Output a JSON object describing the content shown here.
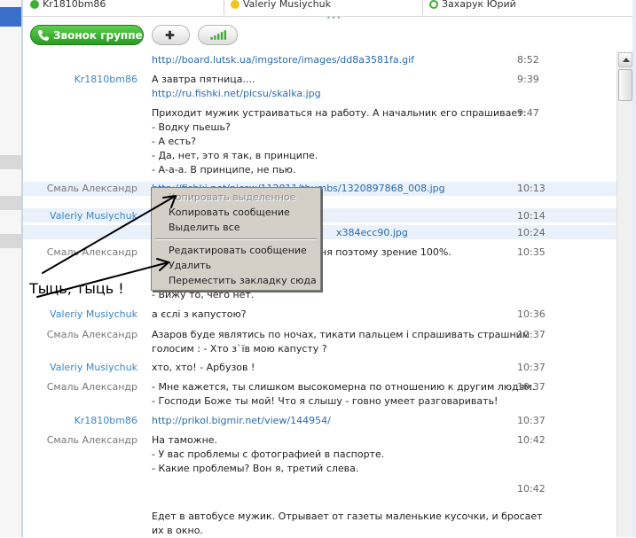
{
  "participants": [
    {
      "name": "Kr1810bm86",
      "icon": "skype-status-icon"
    },
    {
      "name": "Valeriy Musiychuk",
      "icon": "skype-away-icon"
    },
    {
      "name": "Захарук Юрий",
      "icon": "skype-status-icon"
    }
  ],
  "toolbar": {
    "call_group_label": "Звонок группе",
    "add_label": "+",
    "signal_icon": "signal-bars-icon"
  },
  "messages": [
    {
      "name": "",
      "lines": [
        "http://board.lutsk.ua/imgstore/images/dd8a3581fa.gif"
      ],
      "time": "8:52",
      "link": true
    },
    {
      "name": "Kr1810bm86",
      "lines": [
        "А завтра пятница...."
      ],
      "time": "9:39"
    },
    {
      "name": "",
      "lines": [
        "http://ru.fishki.net/picsu/skalka.jpg"
      ],
      "time": "",
      "link": true
    },
    {
      "name": "",
      "lines": [
        "Приходит мужик устраиваться на работу. А начальник его спрашивает:",
        "- Водку пьешь?",
        "- А есть?",
        "- Да, нет, это я так, в принципе.",
        "- А-а-а. В принципе, не пью."
      ],
      "time": "9:47"
    },
    {
      "name": "Смаль Александр",
      "lines": [
        "http://fishki.net/picsw/112011/thumbs/1320897868_008.jpg"
      ],
      "time": "10:13",
      "link": true
    },
    {
      "name": "Valeriy Musiychuk",
      "lines": [
        ""
      ],
      "time": "10:14"
    },
    {
      "name": "",
      "lines": [
        "x384ecc90.jpg"
      ],
      "time": "10:24",
      "link": true
    },
    {
      "name": "Смаль Александр",
      "lines": [
        "ня поэтому зрение 100%."
      ],
      "time": "10:35"
    },
    {
      "name": "",
      "lines": [
        "- Вижу то, чего нет."
      ],
      "time": ""
    },
    {
      "name": "Valeriy Musiychuk",
      "lines": [
        "а єслі з капустою?"
      ],
      "time": "10:36"
    },
    {
      "name": "Смаль Александр",
      "lines": [
        "Азаров буде являтись по ночах, тикати пальцем і спрашивать страшним",
        "голосим : - Хто з`їв мою капусту ?"
      ],
      "time": "10:37"
    },
    {
      "name": "Valeriy Musiychuk",
      "lines": [
        "хто, хто! - Арбузов !"
      ],
      "time": "10:37"
    },
    {
      "name": "Смаль Александр",
      "lines": [
        "- Мне кажется, ты слишком высокомерна по отношению к другим людям.",
        "- Господи Боже ты мой! Что я слышу - говно умеет разговаривать!"
      ],
      "time": "10:37"
    },
    {
      "name": "Kr1810bm86",
      "lines": [
        "http://prikol.bigmir.net/view/144954/"
      ],
      "time": "10:37",
      "link": true
    },
    {
      "name": "Смаль Александр",
      "lines": [
        "На таможне.",
        "- У вас проблемы с фотографией в паспорте.",
        "- Какие проблемы? Вон я, третий слева."
      ],
      "time": "10:42"
    },
    {
      "name": "",
      "lines": [
        ""
      ],
      "time": "10:42"
    },
    {
      "name": "",
      "lines": [
        "Едет в автобусе мужик. Отрывает от газеты маленькие кусочки, и бросает",
        "их в окно."
      ],
      "time": ""
    }
  ],
  "context_menu": {
    "items": [
      {
        "label": "Копировать выделенное",
        "disabled": true
      },
      {
        "label": "Копировать сообщение",
        "disabled": false
      },
      {
        "label": "Выделить все",
        "disabled": false
      },
      {
        "label": "Редактировать сообщение",
        "disabled": false
      },
      {
        "label": "Удалить",
        "disabled": false
      },
      {
        "label": "Переместить закладку сюда",
        "disabled": false
      }
    ]
  },
  "annotation": "Тыць, тыць !",
  "colors": {
    "accent_green": "#2a9a22",
    "link_blue": "#2a6ab0",
    "name_blue": "#3a86c8",
    "menu_bg": "#d4d0c8"
  }
}
